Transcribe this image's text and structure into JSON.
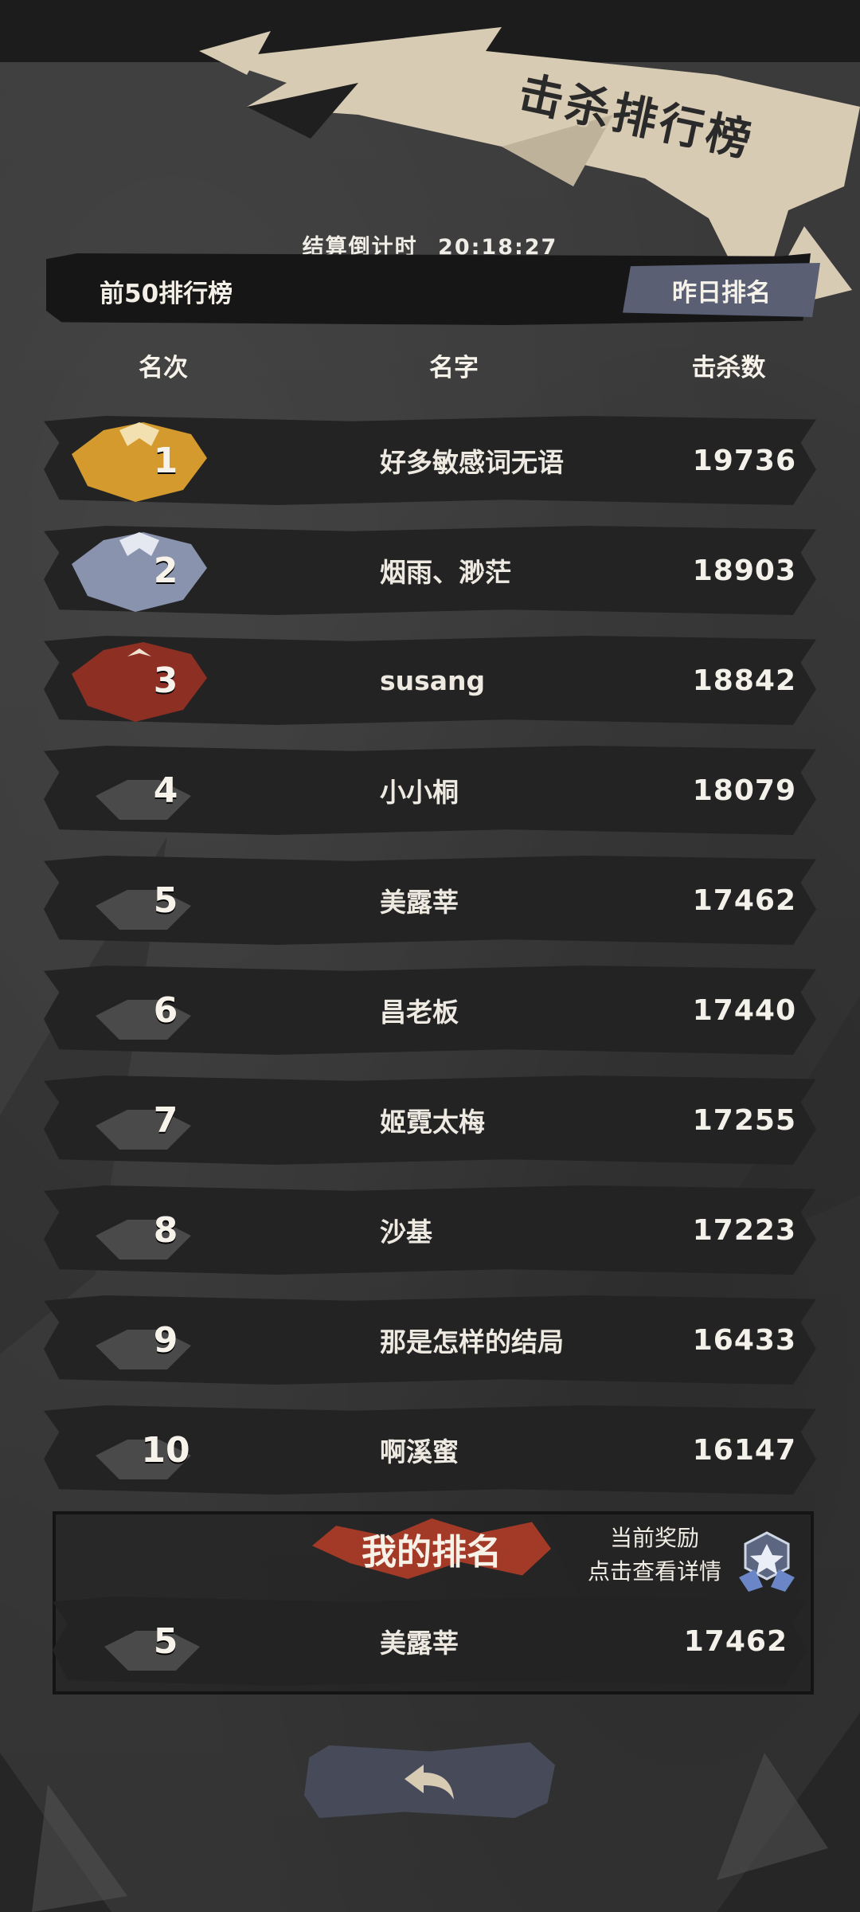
{
  "banner": {
    "title": "击杀排行榜"
  },
  "countdown": {
    "label": "结算倒计时",
    "time": "20:18:27"
  },
  "top_bar": {
    "label": "前50排行榜",
    "yesterday_button": "昨日排名"
  },
  "table": {
    "headers": {
      "rank": "名次",
      "name": "名字",
      "kills": "击杀数"
    },
    "rows": [
      {
        "rank": "1",
        "name": "好多敏感词无语",
        "kills": "19736",
        "tier": "gold"
      },
      {
        "rank": "2",
        "name": "烟雨、渺茫",
        "kills": "18903",
        "tier": "silver"
      },
      {
        "rank": "3",
        "name": "susang",
        "kills": "18842",
        "tier": "bronze"
      },
      {
        "rank": "4",
        "name": "小小桐",
        "kills": "18079",
        "tier": "normal"
      },
      {
        "rank": "5",
        "name": "美露莘",
        "kills": "17462",
        "tier": "normal"
      },
      {
        "rank": "6",
        "name": "昌老板",
        "kills": "17440",
        "tier": "normal"
      },
      {
        "rank": "7",
        "name": "姬霓太梅",
        "kills": "17255",
        "tier": "normal"
      },
      {
        "rank": "8",
        "name": "沙基",
        "kills": "17223",
        "tier": "normal"
      },
      {
        "rank": "9",
        "name": "那是怎样的结局",
        "kills": "16433",
        "tier": "normal"
      },
      {
        "rank": "10",
        "name": "啊溪蜜",
        "kills": "16147",
        "tier": "normal"
      }
    ]
  },
  "my_rank": {
    "title": "我的排名",
    "reward_line1": "当前奖励",
    "reward_line2": "点击查看详情",
    "rank": "5",
    "name": "美露莘",
    "kills": "17462"
  },
  "colors": {
    "gold": "#d49a2e",
    "silver": "#8a93ad",
    "bronze": "#8e2f24",
    "normal": "#4a4a4a",
    "accent_red": "#a23a27"
  },
  "icons": {
    "back": "back-arrow-icon",
    "reward": "reward-medal-icon"
  }
}
